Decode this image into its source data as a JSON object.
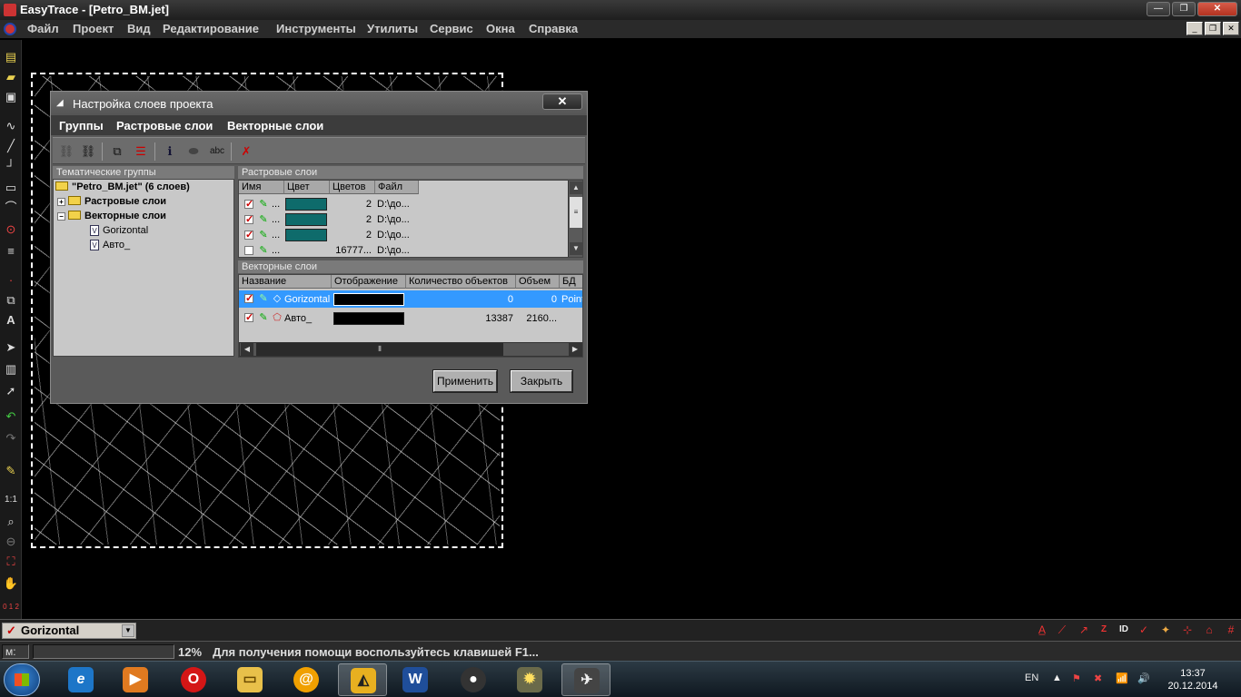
{
  "window": {
    "title": "EasyTrace - [Petro_BM.jet]",
    "controls": {
      "minimize": "—",
      "maximize": "❐",
      "close": "✕"
    }
  },
  "menu": {
    "items": [
      "Файл",
      "Проект",
      "Вид",
      "Редактирование",
      "Инструменты",
      "Утилиты",
      "Сервис",
      "Окна",
      "Справка"
    ]
  },
  "mdi_controls": {
    "minimize": "_",
    "restore": "❐",
    "close": "✕"
  },
  "dialog": {
    "title": "Настройка слоев проекта",
    "close": "✕",
    "menu": [
      "Группы",
      "Растровые слои",
      "Векторные слои"
    ],
    "groups_pane": {
      "header": "Тематические группы",
      "root": "\"Petro_BM.jet\" (6 слоев)",
      "groups": [
        {
          "label": "Растровые слои",
          "expander": "+"
        },
        {
          "label": "Векторные слои",
          "expander": "−"
        }
      ],
      "vector_items": [
        "Gorizontal",
        "Авто_"
      ]
    },
    "raster_pane": {
      "header": "Растровые слои",
      "columns": [
        "Имя",
        "Цвет",
        "Цветов",
        "Файл"
      ],
      "rows": [
        {
          "checked": true,
          "name": "...",
          "color": "#0e6b6b",
          "colors": "2",
          "file": "D:\\до..."
        },
        {
          "checked": true,
          "name": "...",
          "color": "#0e6b6b",
          "colors": "2",
          "file": "D:\\до..."
        },
        {
          "checked": true,
          "name": "...",
          "color": "#0e6b6b",
          "colors": "2",
          "file": "D:\\до..."
        },
        {
          "checked": false,
          "name": "...",
          "color": "",
          "colors": "16777...",
          "file": "D:\\до..."
        }
      ]
    },
    "vector_pane": {
      "header": "Векторные слои",
      "columns": [
        "Название",
        "Отображение",
        "Количество объектов",
        "Объем",
        "БД"
      ],
      "rows": [
        {
          "checked": true,
          "name": "Gorizontal",
          "count": "0",
          "volume": "0",
          "db": "Point",
          "selected": true
        },
        {
          "checked": true,
          "name": "Авто_",
          "count": "13387",
          "volume": "2160...",
          "db": "",
          "selected": false
        }
      ]
    },
    "buttons": {
      "apply": "Применить",
      "close": "Закрыть"
    }
  },
  "layer_bar": {
    "current_layer": "Gorizontal"
  },
  "status_bar": {
    "label_m": "м:",
    "zoom": "12%",
    "help": "Для получения помощи воспользуйтесь клавишей F1..."
  },
  "taskbar": {
    "language": "EN",
    "time": "13:37",
    "date": "20.12.2014"
  },
  "colors": {
    "accent_selection": "#3399ff",
    "raster_swatch": "#0e6b6b",
    "check_red": "#cc0000"
  }
}
